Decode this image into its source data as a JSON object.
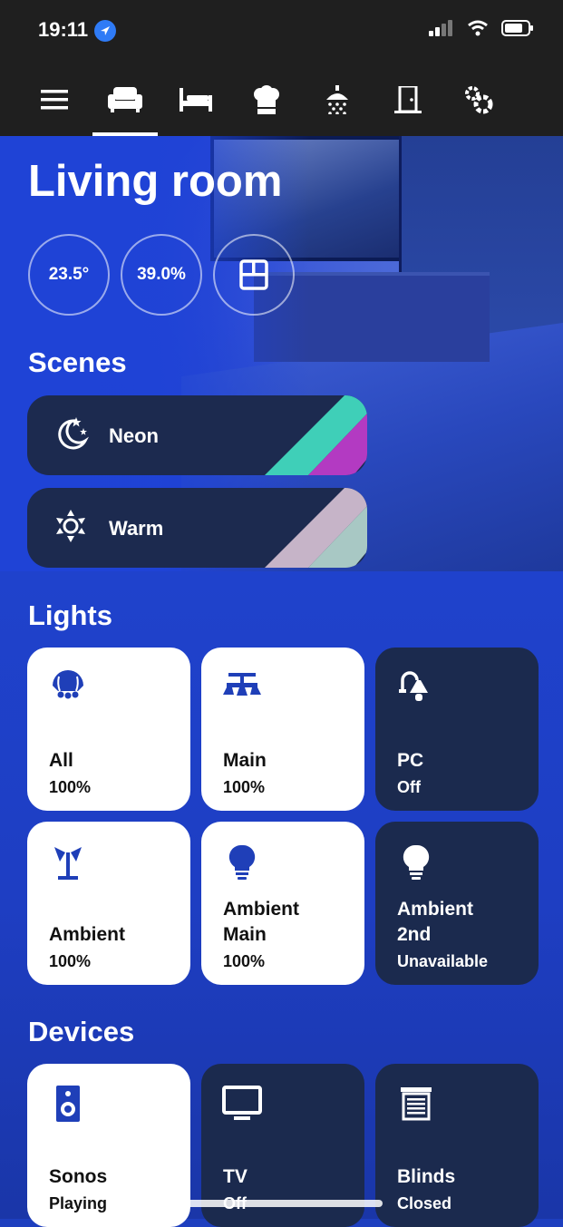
{
  "status": {
    "time": "19:11"
  },
  "nav": {
    "items": [
      {
        "icon": "menu-icon"
      },
      {
        "icon": "sofa-icon",
        "active": true
      },
      {
        "icon": "bed-icon"
      },
      {
        "icon": "chef-hat-icon"
      },
      {
        "icon": "shower-icon"
      },
      {
        "icon": "door-icon"
      },
      {
        "icon": "gears-icon"
      }
    ]
  },
  "room": {
    "title": "Living room",
    "temperature": "23.5°",
    "humidity": "39.0%",
    "window_icon": "window-icon"
  },
  "scenes": {
    "title": "Scenes",
    "items": [
      {
        "label": "Neon",
        "icon": "moon-stars-icon",
        "colors": [
          "#3fcfb8",
          "#b33ac2"
        ]
      },
      {
        "label": "Warm",
        "icon": "sun-icon",
        "colors": [
          "#c6b4c8",
          "#a8c8c4"
        ]
      }
    ]
  },
  "lights": {
    "title": "Lights",
    "items": [
      {
        "name": "All",
        "state": "100%",
        "on": true,
        "icon": "lights-group-icon"
      },
      {
        "name": "Main",
        "state": "100%",
        "on": true,
        "icon": "ceiling-light-icon"
      },
      {
        "name": "PC",
        "state": "Off",
        "on": false,
        "icon": "wall-lamp-icon"
      },
      {
        "name": "Ambient",
        "state": "100%",
        "on": true,
        "icon": "floor-lamp-icon"
      },
      {
        "name": "Ambient Main",
        "name_line1": "Ambient",
        "name_line2": "Main",
        "state": "100%",
        "on": true,
        "icon": "bulb-icon"
      },
      {
        "name": "Ambient 2nd",
        "name_line1": "Ambient",
        "name_line2": "2nd",
        "state": "Unavailable",
        "on": false,
        "icon": "bulb-icon"
      }
    ]
  },
  "devices": {
    "title": "Devices",
    "items": [
      {
        "name": "Sonos",
        "state": "Playing",
        "on": true,
        "icon": "speaker-icon"
      },
      {
        "name": "TV",
        "state": "Off",
        "on": false,
        "icon": "tv-icon"
      },
      {
        "name": "Blinds",
        "state": "Closed",
        "on": false,
        "icon": "blinds-icon"
      }
    ]
  },
  "colors": {
    "accent": "#1f42cc",
    "tile_on": "#ffffff",
    "tile_off": "#1b2a4e",
    "icon_blue": "#1f3fb8"
  }
}
